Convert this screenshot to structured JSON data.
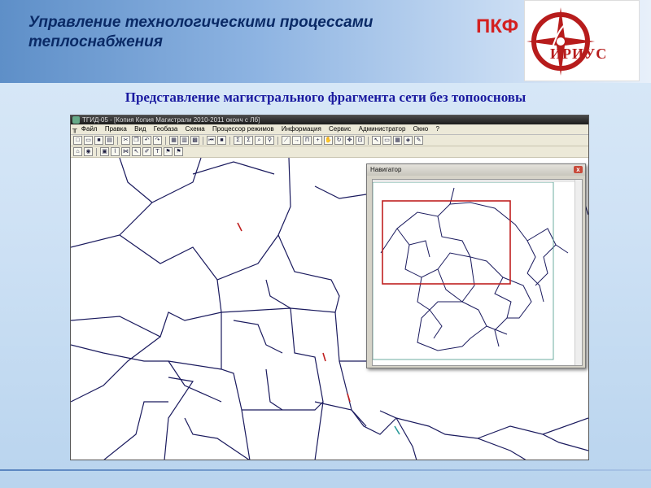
{
  "header": {
    "title_line1": "Управление технологическими процессами",
    "title_line2": "теплоснабжения",
    "brand": "ПКФ",
    "logo_text": "ИРИУС"
  },
  "subtitle": "Представление магистрального фрагмента сети без топоосновы",
  "app": {
    "window_title": "ТГИД-05 - [Копия Копия Магистрали 2010-2011 оконч с Лб]",
    "menu": [
      "Файл",
      "Правка",
      "Вид",
      "Геобаза",
      "Схема",
      "Процессор режимов",
      "Информация",
      "Сервис",
      "Администратор",
      "Окно",
      "?"
    ],
    "navigator": {
      "title": "Навигатор",
      "close": "x"
    }
  },
  "colors": {
    "accent_title": "#0a2a66",
    "brand_red": "#d42020",
    "network_line": "#1a1a5e",
    "navigator_frame": "#c02020"
  },
  "icons": [
    "app-icon",
    "new-file-icon",
    "open-folder-icon",
    "save-icon",
    "print-icon",
    "undo-icon",
    "redo-icon",
    "zoom-icon",
    "pan-hand-icon",
    "refresh-icon",
    "select-arrow-icon",
    "flag-icon",
    "close-icon"
  ]
}
